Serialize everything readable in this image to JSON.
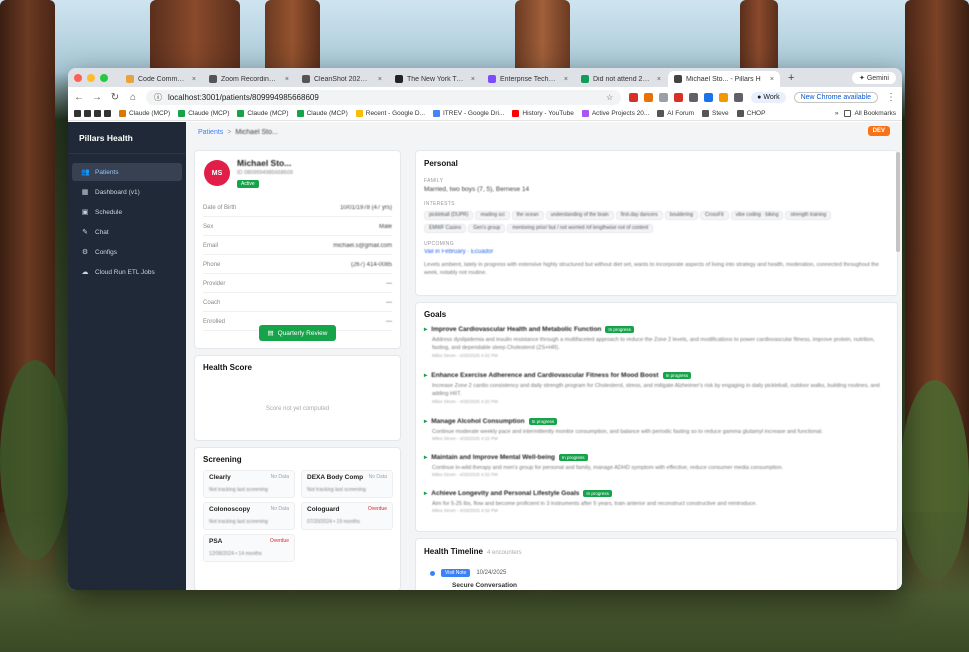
{
  "browser": {
    "tabs": [
      {
        "label": "Code Command Center",
        "color": "#e8a33d",
        "active": false
      },
      {
        "label": "Zoom Recordings - Sc",
        "color": "#555555",
        "active": false
      },
      {
        "label": "CleanShot 2026-02-2",
        "color": "#555555",
        "active": false
      },
      {
        "label": "The New York Times -",
        "color": "#222222",
        "active": false
      },
      {
        "label": "Enterprise Tech Lead",
        "color": "#7c4dff",
        "active": false
      },
      {
        "label": "Did not attend 2024 E",
        "color": "#0f9d58",
        "active": false
      },
      {
        "label": "Michael Sto... - Pillars H",
        "color": "#444444",
        "active": true
      }
    ],
    "new_tab": "+",
    "gemini": "Gemini",
    "url": "localhost:3001/patients/809994985668609",
    "work": "Work",
    "new_chrome": "New Chrome available",
    "bookmarks": [
      {
        "label": "Claude (MCP)",
        "color": "#d97706"
      },
      {
        "label": "Claude (MCP)",
        "color": "#16a34a"
      },
      {
        "label": "Claude (MCP)",
        "color": "#16a34a"
      },
      {
        "label": "Claude (MCP)",
        "color": "#16a34a"
      },
      {
        "label": "Recent - Google D...",
        "color": "#fbbc04"
      },
      {
        "label": "ITREV - Google Dri...",
        "color": "#4285f4"
      },
      {
        "label": "History - YouTube",
        "color": "#ff0000"
      },
      {
        "label": "Active Projects 20...",
        "color": "#a855f7"
      },
      {
        "label": "AI Forum",
        "color": "#555555"
      },
      {
        "label": "Steve",
        "color": "#555555"
      },
      {
        "label": "CHOP",
        "color": "#555555"
      }
    ],
    "all_bookmarks": "All Bookmarks",
    "more": "»"
  },
  "sidebar": {
    "brand": "Pillars Health",
    "items": [
      {
        "label": "Patients",
        "icon": "users-icon",
        "active": true
      },
      {
        "label": "Dashboard (v1)",
        "icon": "grid-icon",
        "active": false
      },
      {
        "label": "Schedule",
        "icon": "calendar-icon",
        "active": false
      },
      {
        "label": "Chat",
        "icon": "chat-icon",
        "active": false
      },
      {
        "label": "Configs",
        "icon": "gear-icon",
        "active": false
      },
      {
        "label": "Cloud Run ETL Jobs",
        "icon": "cloud-icon",
        "active": false
      }
    ]
  },
  "breadcrumb": {
    "root": "Patients",
    "sep": ">",
    "current": "Michael Sto..."
  },
  "dev_badge": "DEV",
  "profile": {
    "initials": "MS",
    "name": "Michael Sto...",
    "subtitle": "ID 0809994985668609",
    "status": "Active",
    "fields": [
      {
        "label": "Date of Birth",
        "value": "10/01/1978 (47 yrs)"
      },
      {
        "label": "Sex",
        "value": "Male"
      },
      {
        "label": "Email",
        "value": "michael.s@gmail.com"
      },
      {
        "label": "Phone",
        "value": "(267) 414-0085"
      },
      {
        "label": "Provider",
        "value": "—"
      },
      {
        "label": "Coach",
        "value": "—"
      },
      {
        "label": "Enrolled",
        "value": "—"
      }
    ],
    "quarterly_review": "Quarterly Review"
  },
  "health_score": {
    "title": "Health Score",
    "empty": "Score not yet computed"
  },
  "screening": {
    "title": "Screening",
    "items": [
      {
        "title": "Clearly",
        "status": "No Data",
        "detail": "Not tracking last screening",
        "overdue": false
      },
      {
        "title": "DEXA Body Comp",
        "status": "No Data",
        "detail": "Not tracking last screening",
        "overdue": false
      },
      {
        "title": "Colonoscopy",
        "status": "No Data",
        "detail": "Not tracking last screening",
        "overdue": false
      },
      {
        "title": "Cologuard",
        "status": "Overdue",
        "detail": "07/20/2024 • 19 months",
        "overdue": true
      },
      {
        "title": "PSA",
        "status": "Overdue",
        "detail": "12/08/2024 • 14 months",
        "overdue": true
      }
    ]
  },
  "personal": {
    "title": "Personal",
    "family_label": "FAMILY",
    "family_value": "Married, two boys (7, 5), Bernese 14",
    "interests_label": "INTERESTS",
    "interests": [
      "pickleball (DUPR)",
      "reading sci",
      "the ocean",
      "understanding of the brain",
      "first-day dancers",
      "bouldering",
      "CrossFit",
      "vibe coding · biking",
      "strength training",
      "EMWF Casino",
      "Gen's group",
      "mentoring prior/ but / not worried /of lengthwise not of content"
    ],
    "upcoming_label": "UPCOMING",
    "upcoming_link": "Vail in February · Ecuador",
    "upcoming_note": "Levels ambient, lately in progress with extensive highly structured but without diet set, wants to incorporate aspects of living into strategy and health, moderation, connected throughout the week, notably not routine."
  },
  "goals": {
    "title": "Goals",
    "items": [
      {
        "title": "Improve Cardiovascular Health and Metabolic Function",
        "badge": "In progress",
        "desc": "Address dyslipidemia and insulin resistance through a multifaceted approach to reduce the Zone 2 levels, and modifications to power cardiovascular fitness, improve protein, nutrition, fasting, and dependable sleep Cholesterol (ZS+HR).",
        "meta": "Miles Strom - 4/25/2025 4:32 PM"
      },
      {
        "title": "Enhance Exercise Adherence and Cardiovascular Fitness for Mood Boost",
        "badge": "In progress",
        "desc": "Increase Zone 2 cardio consistency and daily strength program for Cholesterol, stress, and mitigate Alzheimer's risk by engaging in daily pickleball, outdoor walks, building routines, and adding HIIT.",
        "meta": "Miles Strom - 4/25/2025 4:32 PM"
      },
      {
        "title": "Manage Alcohol Consumption",
        "badge": "In progress",
        "desc": "Continue moderate weekly pace and intermittently monitor consumption, and balance with periodic fasting so to reduce gamma glutamyl increase and functional.",
        "meta": "Miles Strom - 4/25/2025 4:32 PM"
      },
      {
        "title": "Maintain and Improve Mental Well-being",
        "badge": "In progress",
        "desc": "Continue in-wild therapy and men's group for personal and family, manage ADHD symptom with effective, reduce consumer media consumption.",
        "meta": "Miles Strom - 4/25/2025 4:32 PM"
      },
      {
        "title": "Achieve Longevity and Personal Lifestyle Goals",
        "badge": "In progress",
        "desc": "Aim for 5-25 lbs, flow and become proficient in 3 instruments after 5 years, train anterior and reconstruct constructive and reintroduce.",
        "meta": "Miles Strom - 4/25/2025 4:32 PM"
      }
    ]
  },
  "timeline": {
    "title": "Health Timeline",
    "count": "4 encounters",
    "entries": [
      {
        "badge": "Visit Note",
        "date": "10/24/2025",
        "title": "Secure Conversation"
      }
    ]
  }
}
